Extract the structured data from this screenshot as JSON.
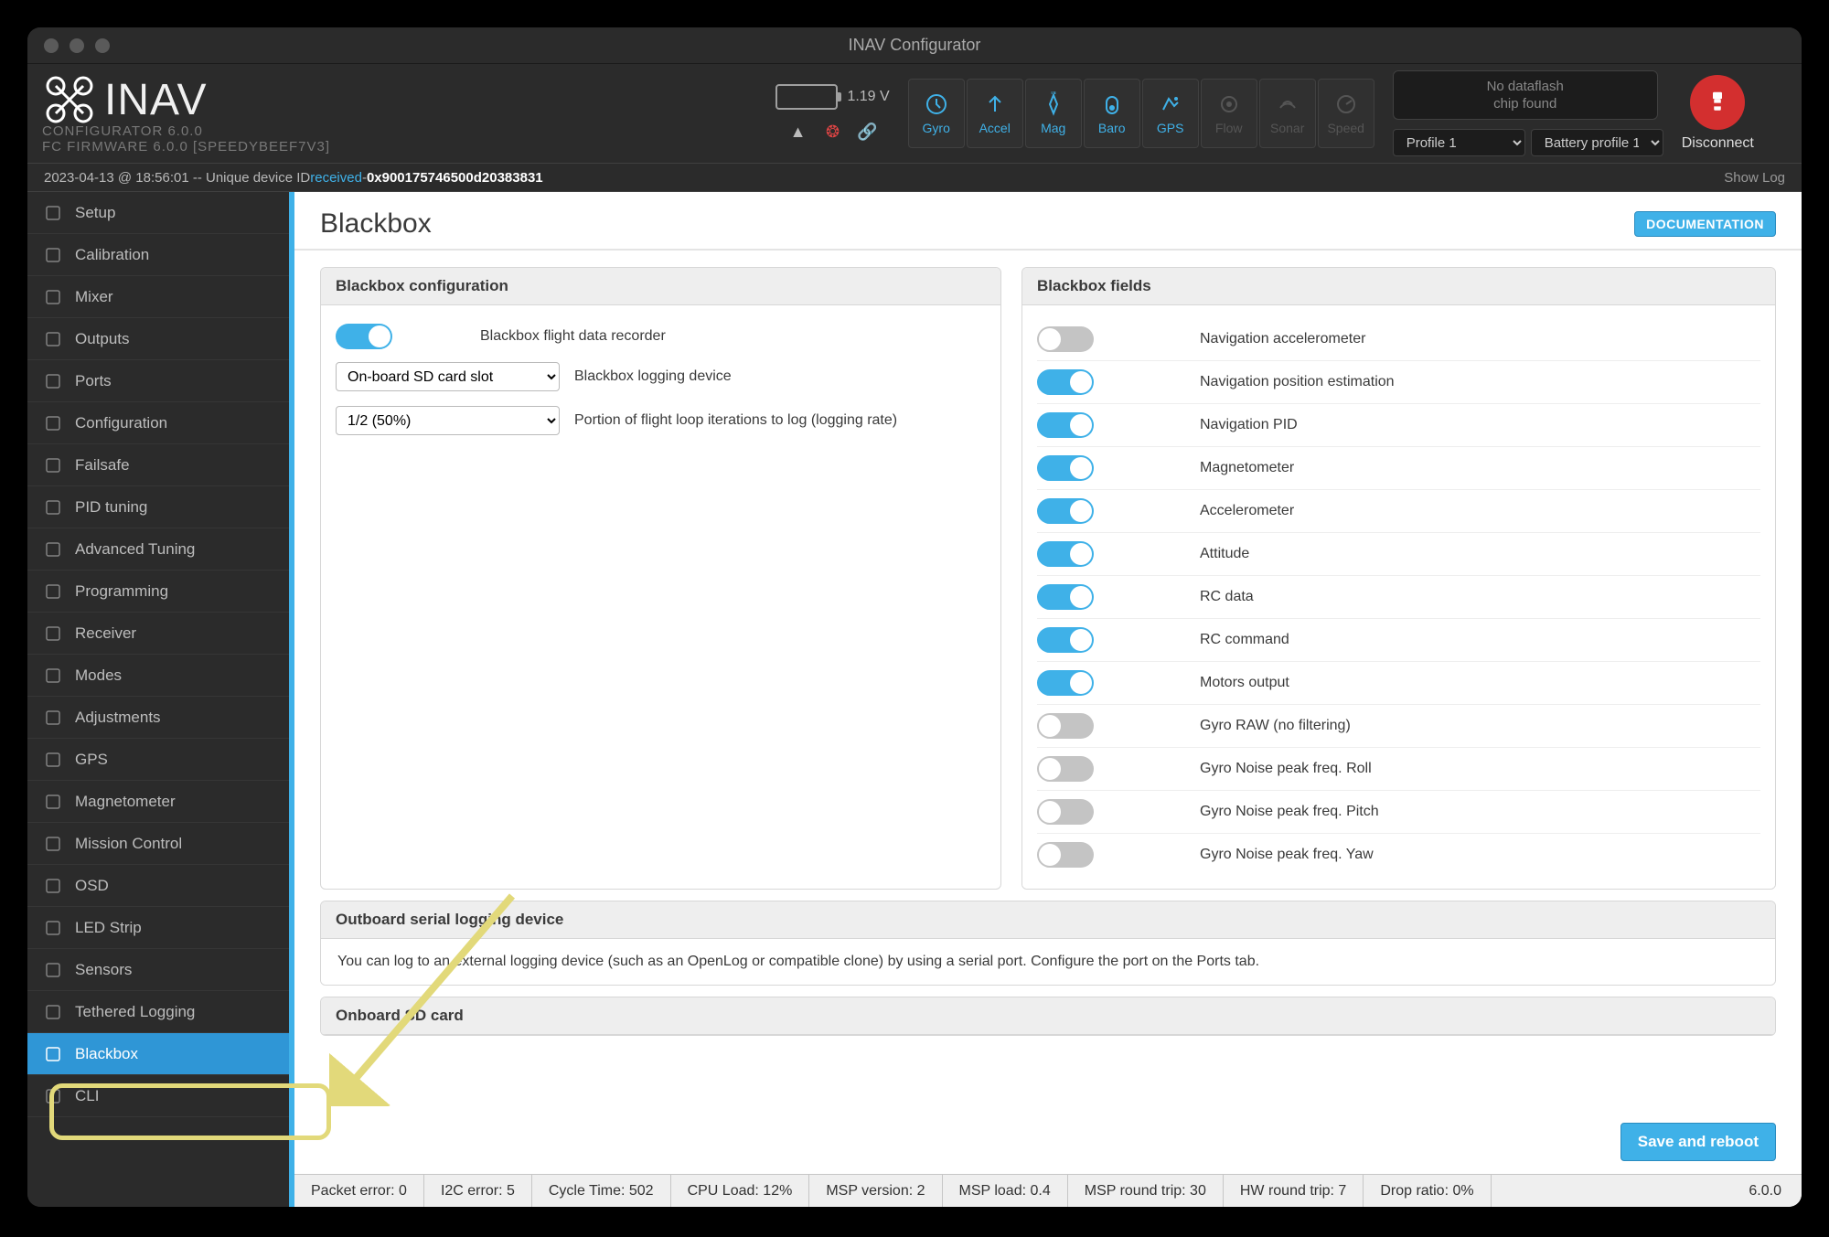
{
  "window_title": "INAV Configurator",
  "logo": {
    "brand": "INAV",
    "line1": "CONFIGURATOR  6.0.0",
    "line2": "FC FIRMWARE     6.0.0 [SPEEDYBEEF7V3]"
  },
  "voltage": "1.19 V",
  "sensors": [
    {
      "label": "Gyro",
      "on": true
    },
    {
      "label": "Accel",
      "on": true
    },
    {
      "label": "Mag",
      "on": true
    },
    {
      "label": "Baro",
      "on": true
    },
    {
      "label": "GPS",
      "on": true
    },
    {
      "label": "Flow",
      "on": false
    },
    {
      "label": "Sonar",
      "on": false
    },
    {
      "label": "Speed",
      "on": false
    }
  ],
  "dataflash": {
    "l1": "No dataflash",
    "l2": "chip found"
  },
  "profile": {
    "a": "Profile 1",
    "b": "Battery profile 1"
  },
  "disconnect": "Disconnect",
  "info_bar": {
    "prefix": "2023-04-13 @ 18:56:01 -- Unique device ID ",
    "recv": "received",
    "dash": " - ",
    "uid": "0x900175746500d20383831"
  },
  "show_log": "Show Log",
  "sidebar": [
    "Setup",
    "Calibration",
    "Mixer",
    "Outputs",
    "Ports",
    "Configuration",
    "Failsafe",
    "PID tuning",
    "Advanced Tuning",
    "Programming",
    "Receiver",
    "Modes",
    "Adjustments",
    "GPS",
    "Magnetometer",
    "Mission Control",
    "OSD",
    "LED Strip",
    "Sensors",
    "Tethered Logging",
    "Blackbox",
    "CLI"
  ],
  "active_item": "Blackbox",
  "page": {
    "title": "Blackbox",
    "doc_btn": "DOCUMENTATION",
    "config_header": "Blackbox configuration",
    "recorder_label": "Blackbox flight data recorder",
    "device_sel": "On-board SD card slot",
    "device_label": "Blackbox logging device",
    "rate_sel": "1/2 (50%)",
    "rate_label": "Portion of flight loop iterations to log (logging rate)",
    "fields_header": "Blackbox fields",
    "fields": [
      {
        "label": "Navigation accelerometer",
        "on": false
      },
      {
        "label": "Navigation position estimation",
        "on": true
      },
      {
        "label": "Navigation PID",
        "on": true
      },
      {
        "label": "Magnetometer",
        "on": true
      },
      {
        "label": "Accelerometer",
        "on": true
      },
      {
        "label": "Attitude",
        "on": true
      },
      {
        "label": "RC data",
        "on": true
      },
      {
        "label": "RC command",
        "on": true
      },
      {
        "label": "Motors output",
        "on": true
      },
      {
        "label": "Gyro RAW (no filtering)",
        "on": false
      },
      {
        "label": "Gyro Noise peak freq. Roll",
        "on": false
      },
      {
        "label": "Gyro Noise peak freq. Pitch",
        "on": false
      },
      {
        "label": "Gyro Noise peak freq. Yaw",
        "on": false
      }
    ],
    "outboard_header": "Outboard serial logging device",
    "outboard_text": "You can log to an external logging device (such as an OpenLog or compatible clone) by using a serial port. Configure the port on the Ports tab.",
    "sd_header": "Onboard SD card",
    "save_btn": "Save and reboot"
  },
  "status": {
    "packet": "Packet error: 0",
    "i2c": "I2C error: 5",
    "cycle": "Cycle Time: 502",
    "cpu": "CPU Load: 12%",
    "mspv": "MSP version: 2",
    "mspl": "MSP load: 0.4",
    "mspr": "MSP round trip: 30",
    "hwr": "HW round trip: 7",
    "drop": "Drop ratio: 0%",
    "ver": "6.0.0"
  }
}
